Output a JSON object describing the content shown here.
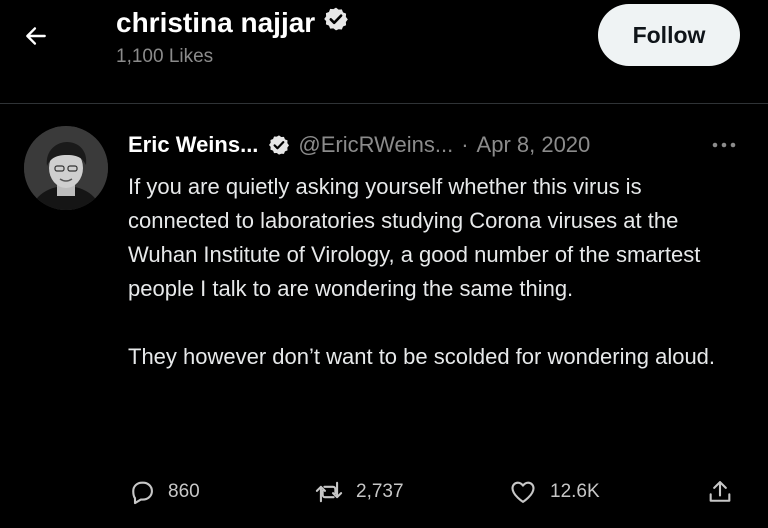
{
  "header": {
    "profile_name": "christina najjar",
    "likes": "1,100 Likes",
    "follow_label": "Follow"
  },
  "tweet": {
    "author_name": "Eric Weins...",
    "handle": "@EricRWeins...",
    "separator": "·",
    "date": "Apr 8, 2020",
    "text_paragraphs": [
      "If you are quietly asking yourself whether this virus is connected to laboratories studying Corona viruses at the Wuhan Institute of Virology, a good number of the smartest people I talk to are wondering the same thing.",
      "They however don’t want to be scolded for wondering aloud."
    ],
    "stats": {
      "replies": "860",
      "retweets": "2,737",
      "likes": "12.6K"
    }
  },
  "icons": {
    "back": "arrow-left-icon",
    "verified": "verified-badge-icon",
    "more": "more-horizontal-icon",
    "reply": "reply-icon",
    "retweet": "retweet-icon",
    "like": "heart-icon",
    "share": "share-icon"
  }
}
